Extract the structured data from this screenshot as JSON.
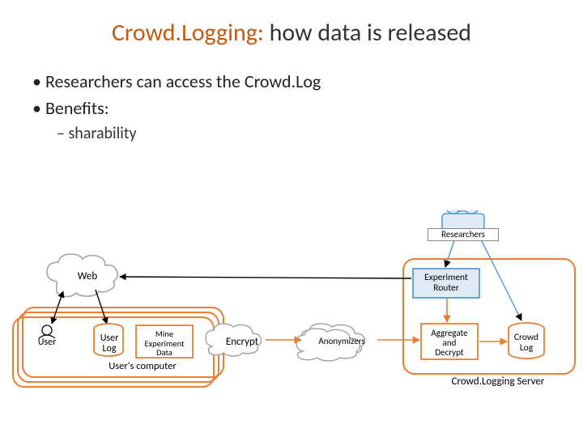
{
  "title_accent": "Crowd.Logging:",
  "title_rest": " how data is released",
  "bullets": [
    "Researchers can access the Crowd.Log",
    "Benefits:"
  ],
  "sub_bullets": [
    "sharability"
  ],
  "diagram": {
    "web": "Web",
    "researchers": "Researchers",
    "user": "User",
    "user_log": "User\nLog",
    "mine": "Mine\nExperiment\nData",
    "encrypt": "Encrypt",
    "anonymizers": "Anonymizers",
    "exp_router": "Experiment\nRouter",
    "agg_decrypt": "Aggregate\nand\nDecrypt",
    "crowd_log": "Crowd\nLog",
    "users_computer": "User's computer",
    "server": "Crowd.Logging Server"
  },
  "colors": {
    "accent": "#c55a11",
    "box": "#ed7d31",
    "cloud": "#a5a5a5",
    "router_fill": "#deebf7",
    "router_border": "#5b9bd5"
  }
}
